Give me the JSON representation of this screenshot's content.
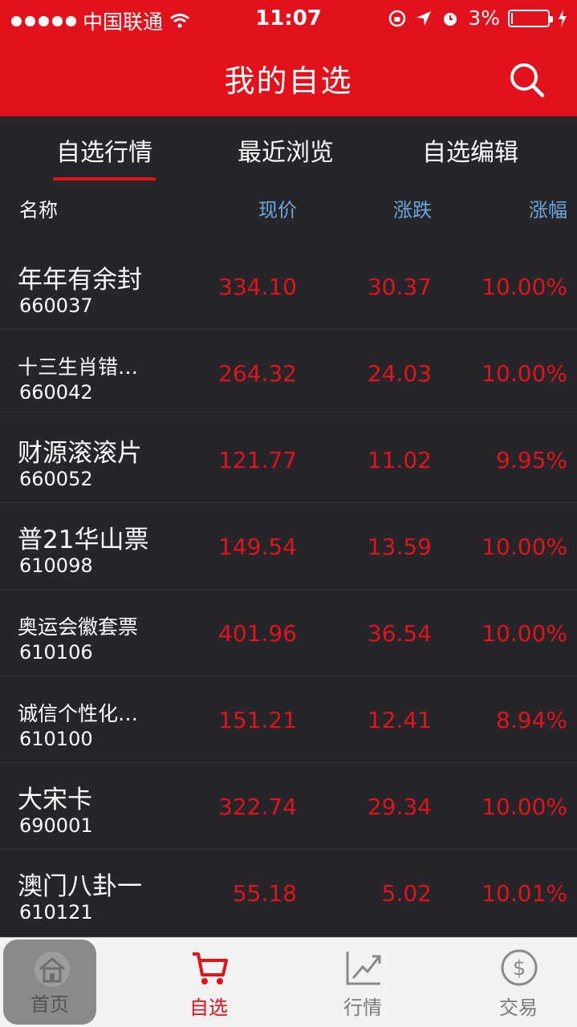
{
  "status_bar": {
    "carrier": "中国联通",
    "time": "11:07",
    "battery": "3%",
    "battery_level": 0.03
  },
  "header": {
    "title": "我的自选"
  },
  "tabs": [
    {
      "label": "自选行情",
      "active": true
    },
    {
      "label": "最近浏览",
      "active": false
    },
    {
      "label": "自选编辑",
      "active": false
    }
  ],
  "columns": {
    "name": "名称",
    "price": "现价",
    "change": "涨跌",
    "change_pct": "涨幅"
  },
  "rows": [
    {
      "name": "年年有余封",
      "code": "660037",
      "price": "334.10",
      "change": "30.37",
      "pct": "10.00%"
    },
    {
      "name": "十三生肖错…",
      "code": "660042",
      "price": "264.32",
      "change": "24.03",
      "pct": "10.00%"
    },
    {
      "name": "财源滚滚片",
      "code": "660052",
      "price": "121.77",
      "change": "11.02",
      "pct": "9.95%"
    },
    {
      "name": "普21华山票",
      "code": "610098",
      "price": "149.54",
      "change": "13.59",
      "pct": "10.00%"
    },
    {
      "name": "奥运会徽套票",
      "code": "610106",
      "price": "401.96",
      "change": "36.54",
      "pct": "10.00%"
    },
    {
      "name": "诚信个性化…",
      "code": "610100",
      "price": "151.21",
      "change": "12.41",
      "pct": "8.94%"
    },
    {
      "name": "大宋卡",
      "code": "690001",
      "price": "322.74",
      "change": "29.34",
      "pct": "10.00%"
    },
    {
      "name": "澳门八卦一",
      "code": "610121",
      "price": "55.18",
      "change": "5.02",
      "pct": "10.01%"
    }
  ],
  "tabbar": {
    "home": "首页",
    "favorites": "自选",
    "market": "行情",
    "trade": "交易"
  },
  "colors": {
    "brand_red": "#e2111b",
    "price_red": "#e0141c",
    "header_blue": "#6aa8de",
    "background": "#26252a"
  }
}
